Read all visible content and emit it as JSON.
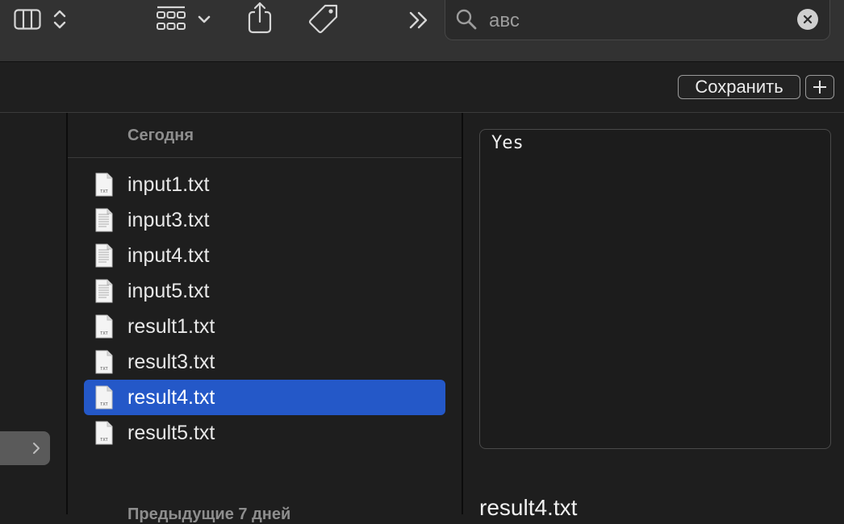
{
  "toolbar": {
    "icons": [
      "columns-view-icon",
      "up-down-chevron-icon",
      "group-grid-icon",
      "chevron-down-icon",
      "share-icon",
      "tag-icon",
      "more-chevrons-icon"
    ]
  },
  "search": {
    "value": "авс",
    "icon": "search-icon",
    "clear_icon": "clear-icon"
  },
  "actions": {
    "save_label": "Сохранить",
    "add_label": "+"
  },
  "sections": {
    "today": "Сегодня",
    "previous": "Предыдущие 7 дней"
  },
  "files": [
    {
      "name": "input1.txt",
      "selected": false
    },
    {
      "name": "input3.txt",
      "selected": false
    },
    {
      "name": "input4.txt",
      "selected": false
    },
    {
      "name": "input5.txt",
      "selected": false
    },
    {
      "name": "result1.txt",
      "selected": false
    },
    {
      "name": "result3.txt",
      "selected": false
    },
    {
      "name": "result4.txt",
      "selected": true
    },
    {
      "name": "result5.txt",
      "selected": false
    }
  ],
  "preview": {
    "content": "Yes",
    "filename": "result4.txt"
  },
  "colors": {
    "selection": "#2458c8",
    "toolbar": "#323232",
    "background": "#1e1e1e"
  }
}
